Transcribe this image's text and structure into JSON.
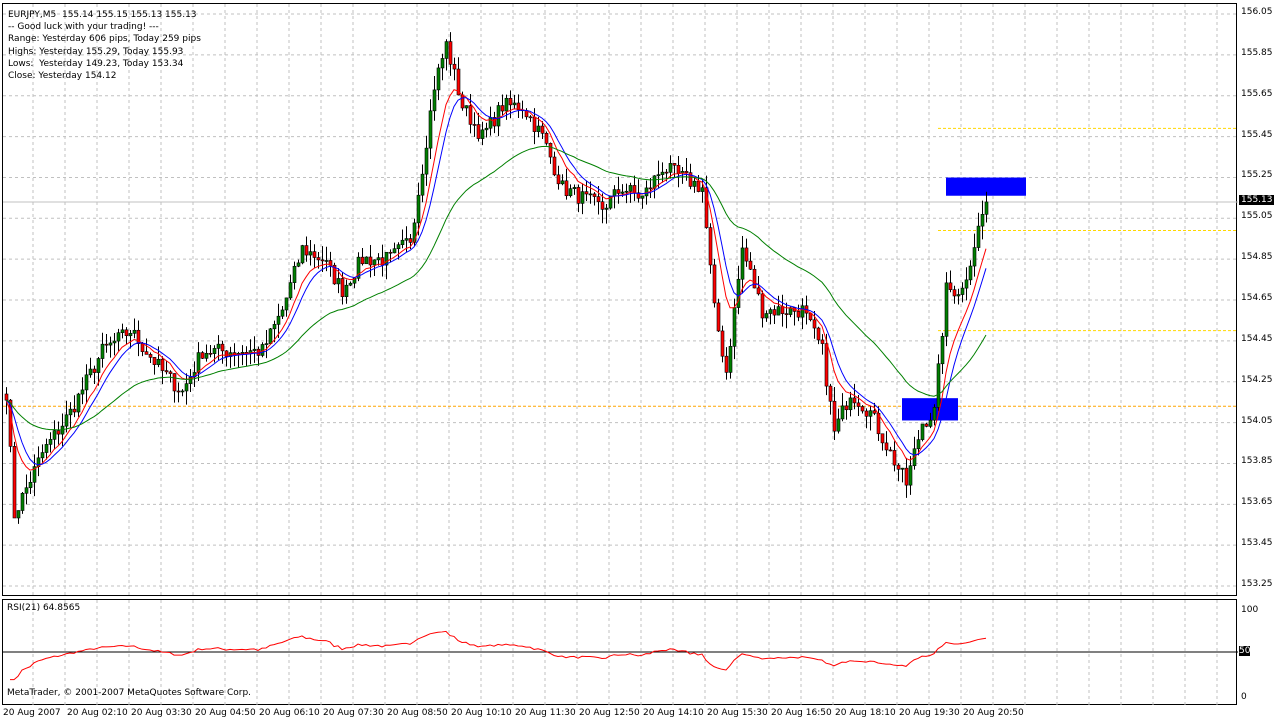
{
  "header": {
    "symbol_line": "EURJPY,M5  155.14 155.15 155.13 155.13",
    "lines": [
      "-- Good luck with your trading! ---",
      "Range: Yesterday 606 pips, Today 259 pips",
      "Highs: Yesterday 155.29, Today 155.93",
      "Lows:  Yesterday 149.23, Today 153.34",
      "Close: Yesterday 154.12"
    ]
  },
  "price_axis": [
    "156.05",
    "155.85",
    "155.65",
    "155.45",
    "155.25",
    "155.05",
    "154.85",
    "154.65",
    "154.45",
    "154.25",
    "154.05",
    "153.85",
    "153.65",
    "153.45",
    "153.25"
  ],
  "current_price": "155.13",
  "rsi": {
    "label": "RSI(21) 64.8565",
    "axis": [
      "100",
      "50",
      "0"
    ],
    "period": 21
  },
  "copyright": "MetaTrader, © 2001-2007 MetaQuotes Software Corp.",
  "time_axis": [
    "20 Aug 2007",
    "20 Aug 02:10",
    "20 Aug 03:30",
    "20 Aug 04:50",
    "20 Aug 06:10",
    "20 Aug 07:30",
    "20 Aug 08:50",
    "20 Aug 10:10",
    "20 Aug 11:30",
    "20 Aug 12:50",
    "20 Aug 14:10",
    "20 Aug 15:30",
    "20 Aug 16:50",
    "20 Aug 18:10",
    "20 Aug 19:30",
    "20 Aug 20:50"
  ],
  "colors": {
    "up": "#008000",
    "down": "#ff0000",
    "ma_fast": "#ff0000",
    "ma_mid": "#0000ff",
    "ma_slow": "#008000",
    "zone": "#0000ff",
    "level": "#ffa500",
    "level2": "#ffd700"
  },
  "chart_data": {
    "type": "candlestick",
    "timeframe": "M5",
    "bars": 246,
    "price_range": [
      153.2,
      156.1
    ],
    "close_path": [
      [
        0,
        154.2
      ],
      [
        2,
        153.6
      ],
      [
        9,
        153.9
      ],
      [
        16,
        154.1
      ],
      [
        24,
        154.4
      ],
      [
        31,
        154.5
      ],
      [
        39,
        154.3
      ],
      [
        44,
        154.2
      ],
      [
        49,
        154.4
      ],
      [
        56,
        154.4
      ],
      [
        64,
        154.4
      ],
      [
        69,
        154.6
      ],
      [
        74,
        154.9
      ],
      [
        79,
        154.85
      ],
      [
        84,
        154.7
      ],
      [
        89,
        154.85
      ],
      [
        96,
        154.85
      ],
      [
        101,
        154.95
      ],
      [
        104,
        155.3
      ],
      [
        107,
        155.7
      ],
      [
        110,
        155.9
      ],
      [
        114,
        155.6
      ],
      [
        119,
        155.45
      ],
      [
        124,
        155.6
      ],
      [
        129,
        155.6
      ],
      [
        134,
        155.45
      ],
      [
        139,
        155.2
      ],
      [
        144,
        155.15
      ],
      [
        149,
        155.1
      ],
      [
        154,
        155.2
      ],
      [
        159,
        155.15
      ],
      [
        164,
        155.3
      ],
      [
        169,
        155.25
      ],
      [
        174,
        155.2
      ],
      [
        177,
        154.6
      ],
      [
        180,
        154.3
      ],
      [
        184,
        154.9
      ],
      [
        189,
        154.6
      ],
      [
        194,
        154.6
      ],
      [
        199,
        154.6
      ],
      [
        204,
        154.4
      ],
      [
        207,
        154.0
      ],
      [
        211,
        154.2
      ],
      [
        216,
        154.1
      ],
      [
        221,
        153.9
      ],
      [
        225,
        153.75
      ],
      [
        229,
        154.05
      ],
      [
        232,
        154.1
      ],
      [
        235,
        154.7
      ],
      [
        239,
        154.7
      ],
      [
        243,
        155.0
      ],
      [
        245,
        155.13
      ]
    ],
    "levels": [
      {
        "price": 154.13,
        "style": "orange-dashed"
      },
      {
        "price": 155.49,
        "style": "yellow-dashed"
      },
      {
        "price": 154.99,
        "style": "yellow-dashed"
      },
      {
        "price": 154.5,
        "style": "yellow-dashed"
      }
    ],
    "zones": [
      {
        "from_bar": 224,
        "to_bar": 238,
        "low": 154.08,
        "high": 154.15
      },
      {
        "from_bar": 235,
        "to_bar": 255,
        "low": 155.18,
        "high": 155.23
      }
    ]
  }
}
